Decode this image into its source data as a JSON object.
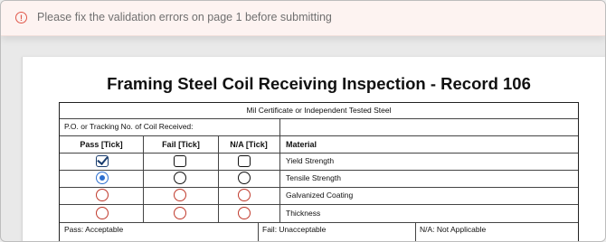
{
  "alert": {
    "message": "Please fix the validation errors on page 1 before submitting",
    "icon": "exclamation-circle-icon",
    "color": "#e0574a"
  },
  "document": {
    "title": "Framing Steel Coil Receiving Inspection - Record 106",
    "section_header": "Mil Certificate or Independent Tested Steel",
    "po_label": "P.O. or Tracking No. of Coil Received:",
    "po_value": "",
    "columns": {
      "pass": "Pass [Tick]",
      "fail": "Fail [Tick]",
      "na": "N/A [Tick]",
      "material": "Material"
    },
    "items": [
      {
        "material": "Yield Strength",
        "control": "checkbox",
        "selected": "pass",
        "error": false
      },
      {
        "material": "Tensile Strength",
        "control": "radio",
        "selected": "pass",
        "error": false
      },
      {
        "material": "Galvanized Coating",
        "control": "radio",
        "selected": null,
        "error": true
      },
      {
        "material": "Thickness",
        "control": "radio",
        "selected": null,
        "error": true
      }
    ],
    "legend": {
      "pass": "Pass: Acceptable",
      "fail": "Fail: Unacceptable",
      "na": "N/A: Not Applicable"
    }
  },
  "colors": {
    "error": "#c0392b",
    "selected": "#2d6fd0",
    "check": "#1a3d6e"
  }
}
